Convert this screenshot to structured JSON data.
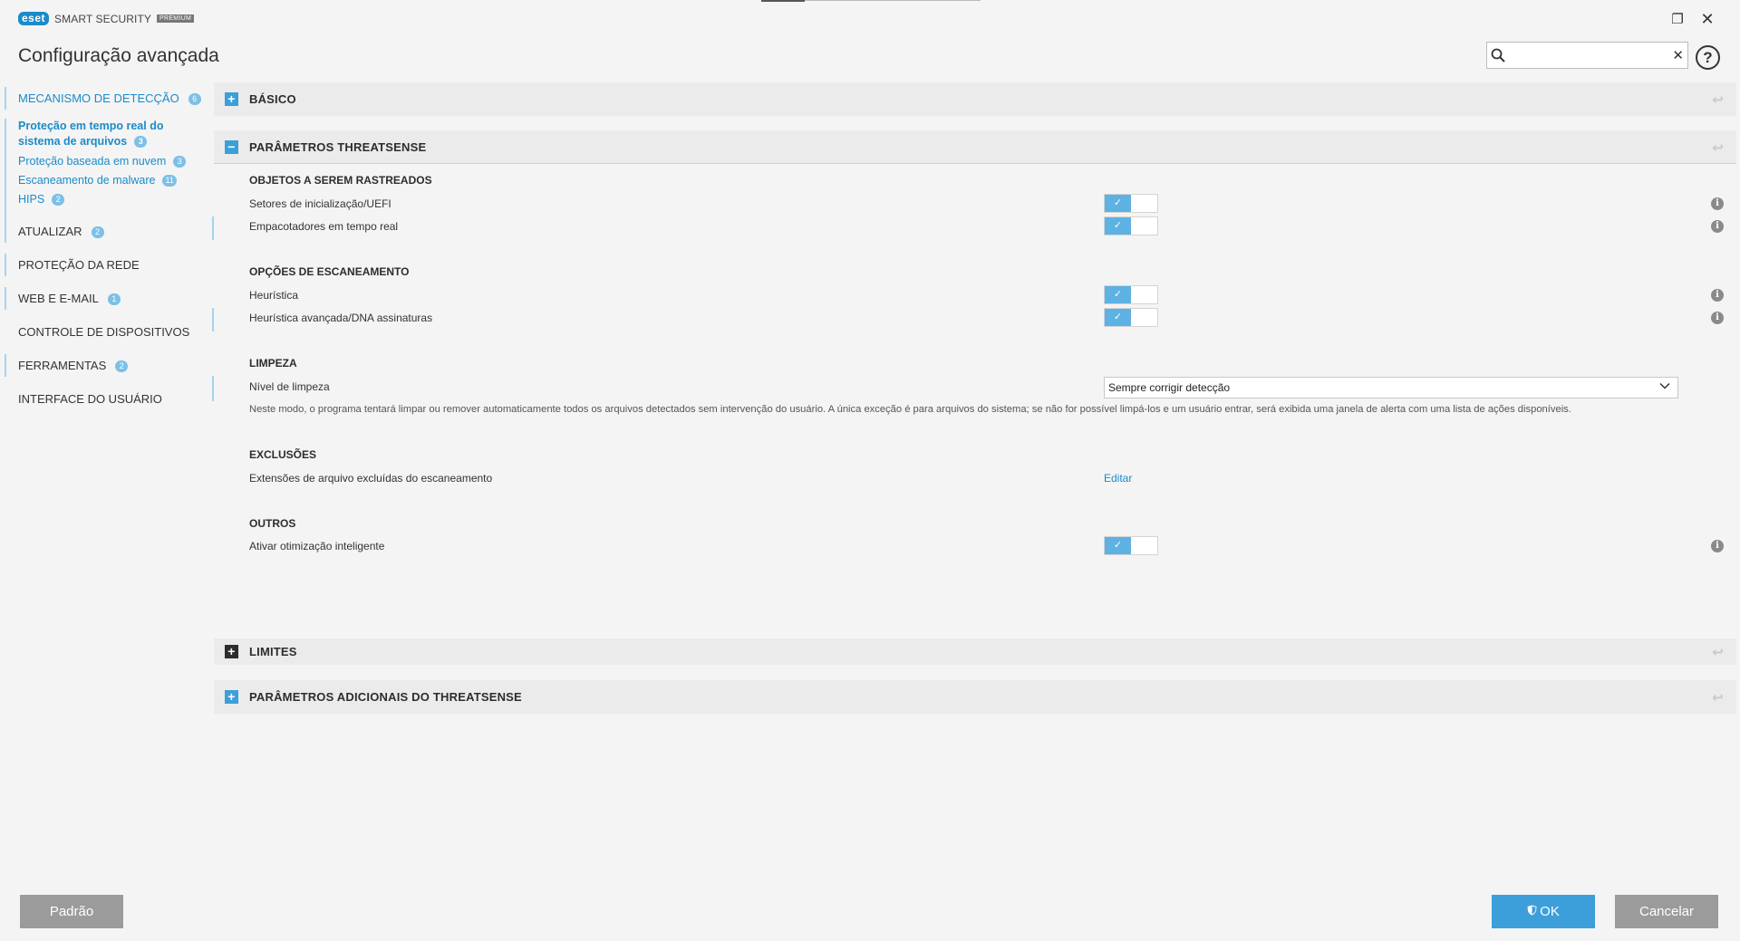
{
  "window": {
    "brand": "eset",
    "product": "SMART SECURITY",
    "edition": "PREMIUM",
    "restore_glyph": "❐",
    "close_glyph": "✕"
  },
  "page_title": "Configuração avançada",
  "search": {
    "placeholder": "",
    "value": "",
    "clear_glyph": "✕"
  },
  "help_glyph": "?",
  "sidebar": {
    "items": [
      {
        "label": "MECANISMO DE DETECÇÃO",
        "badge": "6"
      },
      {
        "label": "ATUALIZAR",
        "badge": "2"
      },
      {
        "label": "PROTEÇÃO DA REDE",
        "badge": ""
      },
      {
        "label": "WEB E E-MAIL",
        "badge": "1"
      },
      {
        "label": "CONTROLE DE DISPOSITIVOS",
        "badge": ""
      },
      {
        "label": "FERRAMENTAS",
        "badge": "2"
      },
      {
        "label": "INTERFACE DO USUÁRIO",
        "badge": ""
      }
    ],
    "sub_items": [
      {
        "label": "Proteção em tempo real do sistema de arquivos",
        "line1": "Proteção em tempo real do",
        "line2": "sistema de arquivos",
        "badge": "3"
      },
      {
        "label": "Proteção baseada em nuvem",
        "badge": "3"
      },
      {
        "label": "Escaneamento de malware",
        "badge": "11"
      },
      {
        "label": "HIPS",
        "badge": "2"
      }
    ]
  },
  "sections": {
    "basic": {
      "title": "BÁSICO",
      "toggle": "+"
    },
    "threatsense": {
      "title": "PARÂMETROS THREATSENSE",
      "toggle": "−"
    },
    "limits": {
      "title": "LIMITES",
      "toggle": "+"
    },
    "additional": {
      "title": "PARÂMETROS ADICIONAIS DO THREATSENSE",
      "toggle": "+"
    },
    "reset_glyph": "↩"
  },
  "threatsense": {
    "objects": {
      "title": "OBJETOS A SEREM RASTREADOS",
      "boot_sectors": "Setores de inicialização/UEFI",
      "runtime_packers": "Empacotadores em tempo real"
    },
    "scan_options": {
      "title": "OPÇÕES DE ESCANEAMENTO",
      "heuristics": "Heurística",
      "advanced_heuristics": "Heurística avançada/DNA assinaturas"
    },
    "cleaning": {
      "title": "LIMPEZA",
      "level_label": "Nível de limpeza",
      "level_value": "Sempre corrigir detecção",
      "description": "Neste modo, o programa tentará limpar ou remover automaticamente todos os arquivos detectados sem intervenção do usuário. A única exceção é para arquivos do sistema; se não for possível limpá-los e um usuário entrar, será exibida uma janela de alerta com uma lista de ações disponíveis."
    },
    "exclusions": {
      "title": "EXCLUSÕES",
      "extensions_label": "Extensões de arquivo excluídas do escaneamento",
      "edit_link": "Editar"
    },
    "others": {
      "title": "OUTROS",
      "smart_optimization": "Ativar otimização inteligente"
    },
    "toggles": {
      "boot_sectors": true,
      "runtime_packers": true,
      "heuristics": true,
      "advanced_heuristics": true,
      "smart_optimization": true
    },
    "check_glyph": "✓",
    "info_glyph": "i",
    "chevron_glyph": "⌄"
  },
  "buttons": {
    "default": "Padrão",
    "ok": "OK",
    "cancel": "Cancelar"
  },
  "colors": {
    "accent": "#1b8bc9",
    "toggle_on": "#5db2e3",
    "button_gray": "#9b9b9b",
    "ok_blue": "#3c9fd9"
  }
}
